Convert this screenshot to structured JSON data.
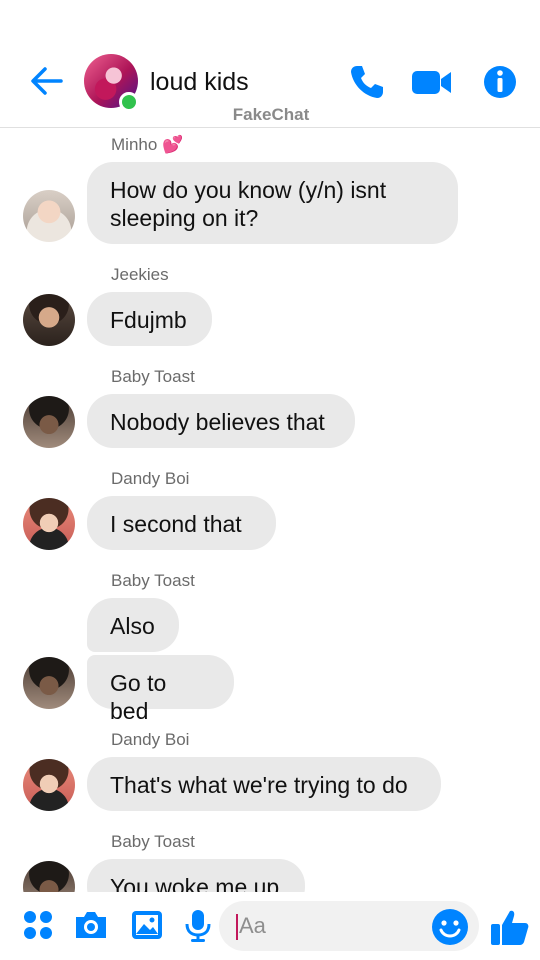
{
  "header": {
    "title": "loud kids",
    "subtitle": "FakeChat",
    "accent_color": "#0084ff",
    "online_color": "#31c24d",
    "icons": [
      "back-arrow-icon",
      "phone-icon",
      "video-camera-icon",
      "info-icon"
    ]
  },
  "messages": [
    {
      "sender": "Minho 💕",
      "text_lines": [
        "How do you know (y/n) isnt",
        "sleeping on it?"
      ],
      "avatar": "minho"
    },
    {
      "sender": "Jeekies",
      "text_lines": [
        "Fdujmb"
      ],
      "avatar": "jeekies"
    },
    {
      "sender": "Baby Toast",
      "text_lines": [
        "Nobody believes that"
      ],
      "avatar": "baby-toast"
    },
    {
      "sender": "Dandy Boi",
      "text_lines": [
        "I second that"
      ],
      "avatar": "dandy-boi"
    },
    {
      "sender": "Baby Toast",
      "text_lines": [
        "Also"
      ],
      "avatar": ""
    },
    {
      "sender": "",
      "text_lines": [
        "Go to bed"
      ],
      "avatar": "baby-toast"
    },
    {
      "sender": "Dandy Boi",
      "text_lines": [
        "That's what we're trying to do"
      ],
      "avatar": "dandy-boi"
    },
    {
      "sender": "Baby Toast",
      "text_lines": [
        "You woke me up"
      ],
      "avatar": "baby-toast"
    }
  ],
  "composer": {
    "placeholder": "Aa",
    "icons": [
      "apps-menu-icon",
      "camera-icon",
      "gallery-icon",
      "microphone-icon",
      "emoji-icon",
      "thumbs-up-icon"
    ]
  }
}
